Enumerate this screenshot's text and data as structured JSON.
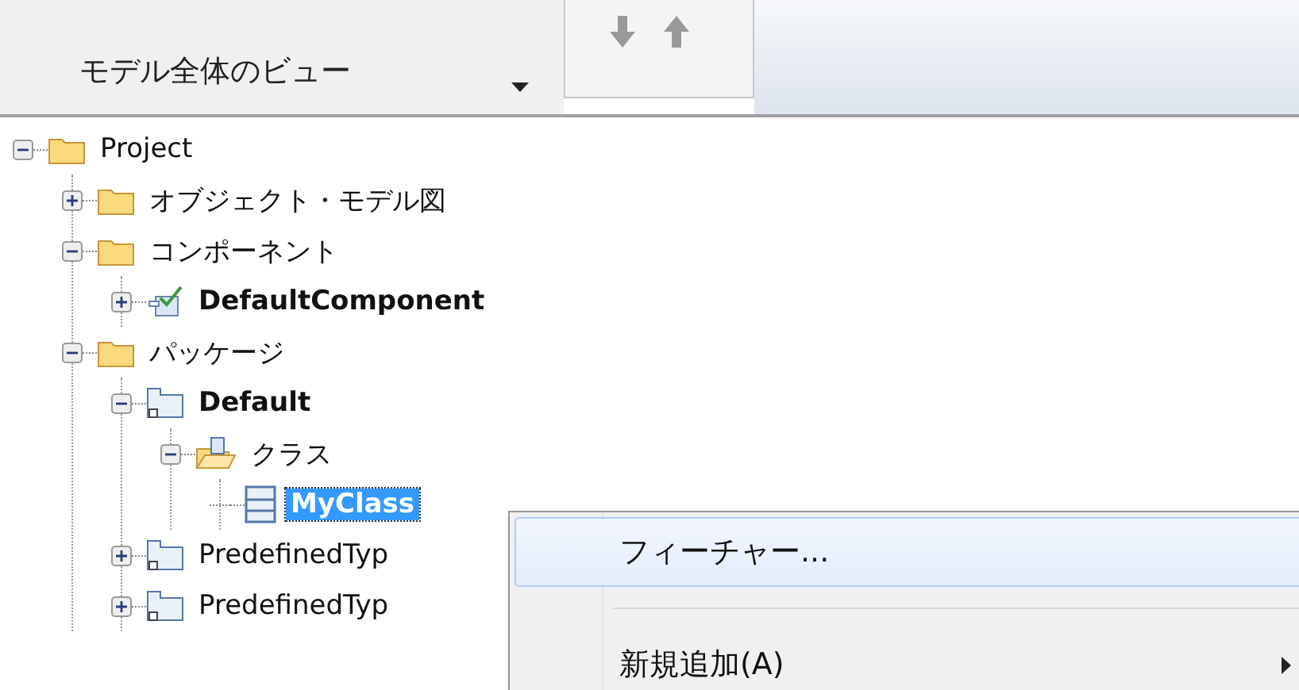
{
  "view_selector": {
    "label": "モデル全体のビュー"
  },
  "tree": [
    {
      "label": "Project",
      "kind": "folder",
      "bold": false,
      "selected": false,
      "expanded": true,
      "children": [
        {
          "label": "オブジェクト・モデル図",
          "kind": "folder",
          "bold": false,
          "selected": false,
          "expanded": false
        },
        {
          "label": "コンポーネント",
          "kind": "folder",
          "bold": false,
          "selected": false,
          "expanded": true,
          "children": [
            {
              "label": "DefaultComponent",
              "kind": "component",
              "bold": true,
              "selected": false,
              "expanded": false
            }
          ]
        },
        {
          "label": "パッケージ",
          "kind": "folder",
          "bold": false,
          "selected": false,
          "expanded": true,
          "children": [
            {
              "label": "Default",
              "kind": "package",
              "bold": true,
              "selected": false,
              "expanded": true,
              "children": [
                {
                  "label": "クラス",
                  "kind": "class-folder",
                  "bold": false,
                  "selected": false,
                  "expanded": true,
                  "children": [
                    {
                      "label": "MyClass",
                      "kind": "class",
                      "bold": true,
                      "selected": true
                    }
                  ]
                }
              ]
            },
            {
              "label": "PredefinedTyp",
              "kind": "package",
              "bold": false,
              "selected": false,
              "expanded": false
            },
            {
              "label": "PredefinedTyp",
              "kind": "package",
              "bold": false,
              "selected": false,
              "expanded": false
            }
          ]
        }
      ]
    }
  ],
  "context_menu": [
    {
      "kind": "item",
      "label": "フィーチャー...",
      "selected": true,
      "submenu": false
    },
    {
      "kind": "separator"
    },
    {
      "kind": "item",
      "label": "新規追加(A)",
      "selected": false,
      "submenu": true
    }
  ]
}
